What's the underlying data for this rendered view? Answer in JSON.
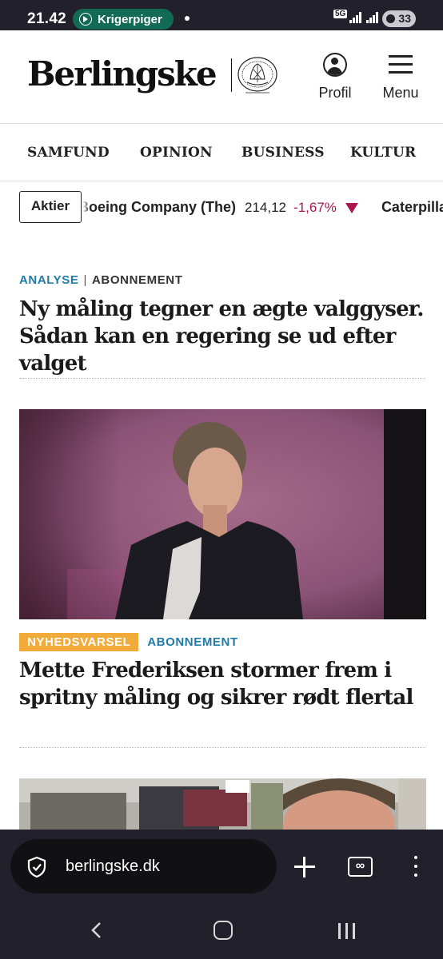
{
  "status_bar": {
    "time": "21.42",
    "notification_pill": "Krigerpiger",
    "network": "5G",
    "battery": "33"
  },
  "header": {
    "logo": "Berlingske",
    "profile_label": "Profil",
    "menu_label": "Menu"
  },
  "sections": [
    "SAMFUND",
    "OPINION",
    "BUSINESS",
    "KULTUR"
  ],
  "ticker": {
    "button_label": "Aktier",
    "items": [
      {
        "name": "Boeing Company (The)",
        "value": "214,12",
        "change": "-1,67%",
        "direction": "down"
      },
      {
        "name": "Caterpillar",
        "value": "",
        "change": "",
        "direction": ""
      }
    ],
    "colors": {
      "negative": "#a8184f"
    }
  },
  "articles": [
    {
      "kicker_primary": "ANALYSE",
      "kicker_separator": "|",
      "kicker_secondary": "ABONNEMENT",
      "headline": "Ny måling tegner en ægte valggyser. Sådan kan en regering se ud efter valget"
    },
    {
      "badge": "NYHEDSVARSEL",
      "kicker_secondary": "ABONNEMENT",
      "headline": "Mette Frederiksen stormer frem i spritny måling og sikrer rødt flertal"
    }
  ],
  "browser": {
    "url": "berlingske.dk",
    "tabs_icon_text": "∞"
  },
  "colors": {
    "kicker_blue": "#1f7aa8",
    "badge_orange": "#f0ab3b",
    "system_bar": "#22212b"
  }
}
